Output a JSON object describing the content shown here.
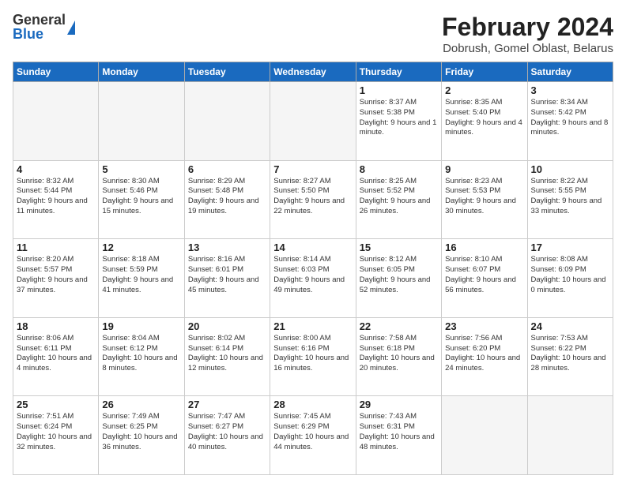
{
  "logo": {
    "general": "General",
    "blue": "Blue"
  },
  "title": "February 2024",
  "subtitle": "Dobrush, Gomel Oblast, Belarus",
  "days_of_week": [
    "Sunday",
    "Monday",
    "Tuesday",
    "Wednesday",
    "Thursday",
    "Friday",
    "Saturday"
  ],
  "weeks": [
    [
      {
        "day": "",
        "info": ""
      },
      {
        "day": "",
        "info": ""
      },
      {
        "day": "",
        "info": ""
      },
      {
        "day": "",
        "info": ""
      },
      {
        "day": "1",
        "info": "Sunrise: 8:37 AM\nSunset: 5:38 PM\nDaylight: 9 hours\nand 1 minute."
      },
      {
        "day": "2",
        "info": "Sunrise: 8:35 AM\nSunset: 5:40 PM\nDaylight: 9 hours\nand 4 minutes."
      },
      {
        "day": "3",
        "info": "Sunrise: 8:34 AM\nSunset: 5:42 PM\nDaylight: 9 hours\nand 8 minutes."
      }
    ],
    [
      {
        "day": "4",
        "info": "Sunrise: 8:32 AM\nSunset: 5:44 PM\nDaylight: 9 hours\nand 11 minutes."
      },
      {
        "day": "5",
        "info": "Sunrise: 8:30 AM\nSunset: 5:46 PM\nDaylight: 9 hours\nand 15 minutes."
      },
      {
        "day": "6",
        "info": "Sunrise: 8:29 AM\nSunset: 5:48 PM\nDaylight: 9 hours\nand 19 minutes."
      },
      {
        "day": "7",
        "info": "Sunrise: 8:27 AM\nSunset: 5:50 PM\nDaylight: 9 hours\nand 22 minutes."
      },
      {
        "day": "8",
        "info": "Sunrise: 8:25 AM\nSunset: 5:52 PM\nDaylight: 9 hours\nand 26 minutes."
      },
      {
        "day": "9",
        "info": "Sunrise: 8:23 AM\nSunset: 5:53 PM\nDaylight: 9 hours\nand 30 minutes."
      },
      {
        "day": "10",
        "info": "Sunrise: 8:22 AM\nSunset: 5:55 PM\nDaylight: 9 hours\nand 33 minutes."
      }
    ],
    [
      {
        "day": "11",
        "info": "Sunrise: 8:20 AM\nSunset: 5:57 PM\nDaylight: 9 hours\nand 37 minutes."
      },
      {
        "day": "12",
        "info": "Sunrise: 8:18 AM\nSunset: 5:59 PM\nDaylight: 9 hours\nand 41 minutes."
      },
      {
        "day": "13",
        "info": "Sunrise: 8:16 AM\nSunset: 6:01 PM\nDaylight: 9 hours\nand 45 minutes."
      },
      {
        "day": "14",
        "info": "Sunrise: 8:14 AM\nSunset: 6:03 PM\nDaylight: 9 hours\nand 49 minutes."
      },
      {
        "day": "15",
        "info": "Sunrise: 8:12 AM\nSunset: 6:05 PM\nDaylight: 9 hours\nand 52 minutes."
      },
      {
        "day": "16",
        "info": "Sunrise: 8:10 AM\nSunset: 6:07 PM\nDaylight: 9 hours\nand 56 minutes."
      },
      {
        "day": "17",
        "info": "Sunrise: 8:08 AM\nSunset: 6:09 PM\nDaylight: 10 hours\nand 0 minutes."
      }
    ],
    [
      {
        "day": "18",
        "info": "Sunrise: 8:06 AM\nSunset: 6:11 PM\nDaylight: 10 hours\nand 4 minutes."
      },
      {
        "day": "19",
        "info": "Sunrise: 8:04 AM\nSunset: 6:12 PM\nDaylight: 10 hours\nand 8 minutes."
      },
      {
        "day": "20",
        "info": "Sunrise: 8:02 AM\nSunset: 6:14 PM\nDaylight: 10 hours\nand 12 minutes."
      },
      {
        "day": "21",
        "info": "Sunrise: 8:00 AM\nSunset: 6:16 PM\nDaylight: 10 hours\nand 16 minutes."
      },
      {
        "day": "22",
        "info": "Sunrise: 7:58 AM\nSunset: 6:18 PM\nDaylight: 10 hours\nand 20 minutes."
      },
      {
        "day": "23",
        "info": "Sunrise: 7:56 AM\nSunset: 6:20 PM\nDaylight: 10 hours\nand 24 minutes."
      },
      {
        "day": "24",
        "info": "Sunrise: 7:53 AM\nSunset: 6:22 PM\nDaylight: 10 hours\nand 28 minutes."
      }
    ],
    [
      {
        "day": "25",
        "info": "Sunrise: 7:51 AM\nSunset: 6:24 PM\nDaylight: 10 hours\nand 32 minutes."
      },
      {
        "day": "26",
        "info": "Sunrise: 7:49 AM\nSunset: 6:25 PM\nDaylight: 10 hours\nand 36 minutes."
      },
      {
        "day": "27",
        "info": "Sunrise: 7:47 AM\nSunset: 6:27 PM\nDaylight: 10 hours\nand 40 minutes."
      },
      {
        "day": "28",
        "info": "Sunrise: 7:45 AM\nSunset: 6:29 PM\nDaylight: 10 hours\nand 44 minutes."
      },
      {
        "day": "29",
        "info": "Sunrise: 7:43 AM\nSunset: 6:31 PM\nDaylight: 10 hours\nand 48 minutes."
      },
      {
        "day": "",
        "info": ""
      },
      {
        "day": "",
        "info": ""
      }
    ]
  ]
}
